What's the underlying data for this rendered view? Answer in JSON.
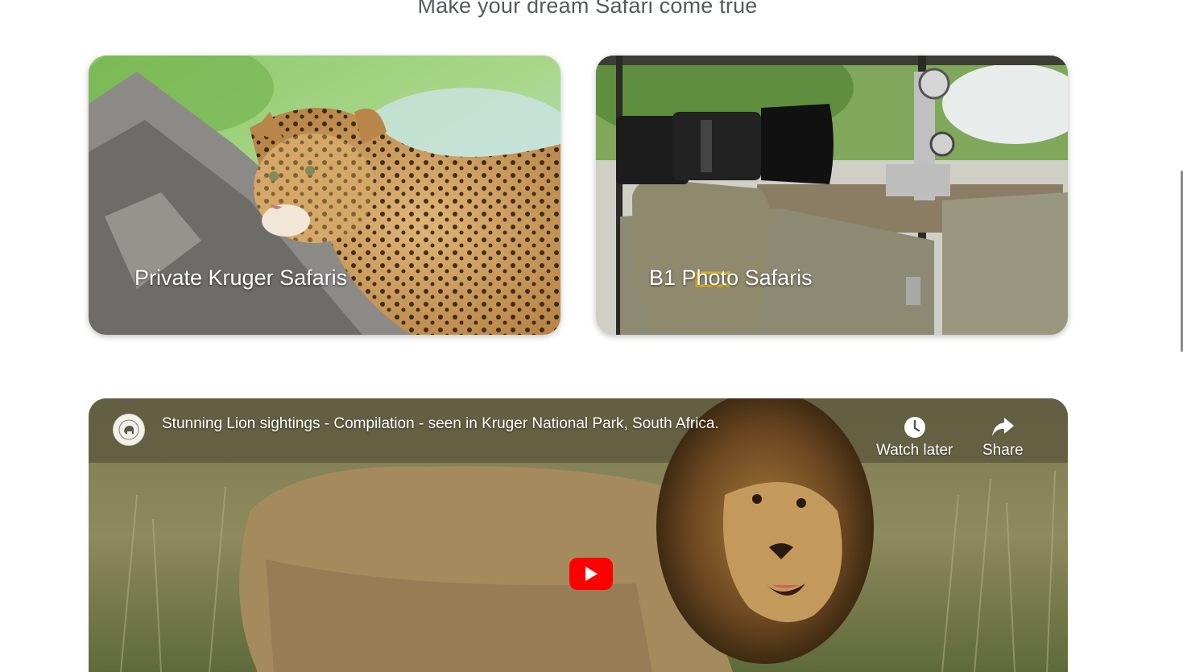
{
  "section": {
    "heading": "Make your dream Safari come true"
  },
  "cards": [
    {
      "label": "Private Kruger Safaris"
    },
    {
      "label": "B1 Photo Safaris"
    }
  ],
  "video": {
    "title": "Stunning Lion sightings - Compilation - seen in Kruger National Park, South Africa.",
    "watch_later_label": "Watch later",
    "share_label": "Share",
    "play_color": "#ff0000"
  }
}
